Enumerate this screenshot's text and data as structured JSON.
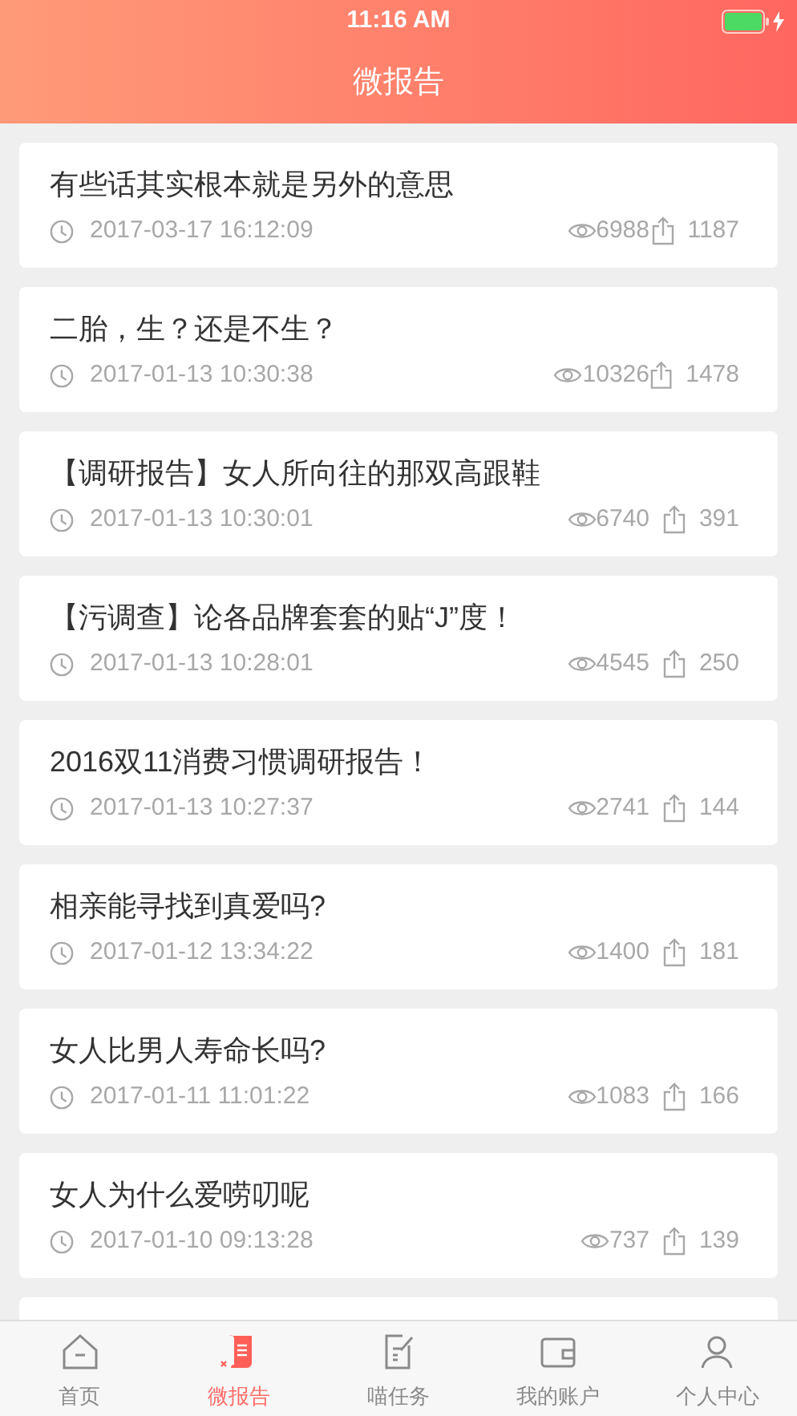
{
  "status_bar": {
    "time": "11:16 AM"
  },
  "nav": {
    "title": "微报告"
  },
  "reports": [
    {
      "title": "有些话其实根本就是另外的意思",
      "time": "2017-03-17 16:12:09",
      "views": "6988",
      "shares": "1187"
    },
    {
      "title": "二胎，生？还是不生？",
      "time": "2017-01-13 10:30:38",
      "views": "10326",
      "shares": "1478"
    },
    {
      "title": "【调研报告】女人所向往的那双高跟鞋",
      "time": "2017-01-13 10:30:01",
      "views": "6740",
      "shares": "391"
    },
    {
      "title": "【污调查】论各品牌套套的贴“J”度！",
      "time": "2017-01-13 10:28:01",
      "views": "4545",
      "shares": "250"
    },
    {
      "title": "2016双11消费习惯调研报告！",
      "time": "2017-01-13 10:27:37",
      "views": "2741",
      "shares": "144"
    },
    {
      "title": "相亲能寻找到真爱吗?",
      "time": "2017-01-12 13:34:22",
      "views": "1400",
      "shares": "181"
    },
    {
      "title": "女人比男人寿命长吗?",
      "time": "2017-01-11 11:01:22",
      "views": "1083",
      "shares": "166"
    },
    {
      "title": "女人为什么爱唠叨呢",
      "time": "2017-01-10 09:13:28",
      "views": "737",
      "shares": "139"
    }
  ],
  "tabs": [
    {
      "label": "首页",
      "kind": "home",
      "selected": false
    },
    {
      "label": "微报告",
      "kind": "report",
      "selected": true
    },
    {
      "label": "喵任务",
      "kind": "task",
      "selected": false
    },
    {
      "label": "我的账户",
      "kind": "wallet",
      "selected": false
    },
    {
      "label": "个人中心",
      "kind": "person",
      "selected": false
    }
  ]
}
